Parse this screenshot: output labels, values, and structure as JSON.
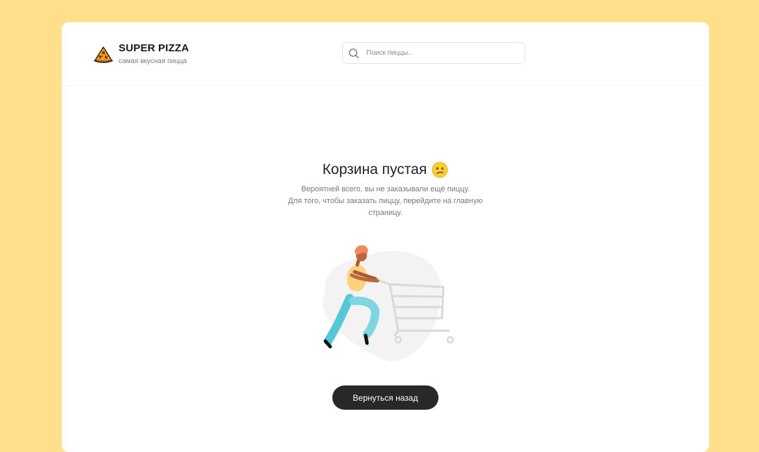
{
  "header": {
    "logo_title": "SUPER PIZZA",
    "logo_subtitle": "самая вкусная пицца",
    "search_placeholder": "Поиск пиццы..",
    "search_value": ""
  },
  "cart": {
    "title": "Корзина пустая",
    "emoji": "confused-face-icon",
    "description_line1": "Вероятней всего, вы не заказывали ещё пиццу.",
    "description_line2": "Для того, чтобы заказать пиццу, перейдите на главную",
    "description_line3": "страницу.",
    "back_button_label": "Вернуться назад"
  },
  "colors": {
    "background": "#ffdf8c",
    "button": "#282828",
    "button_text": "#ffffff"
  }
}
